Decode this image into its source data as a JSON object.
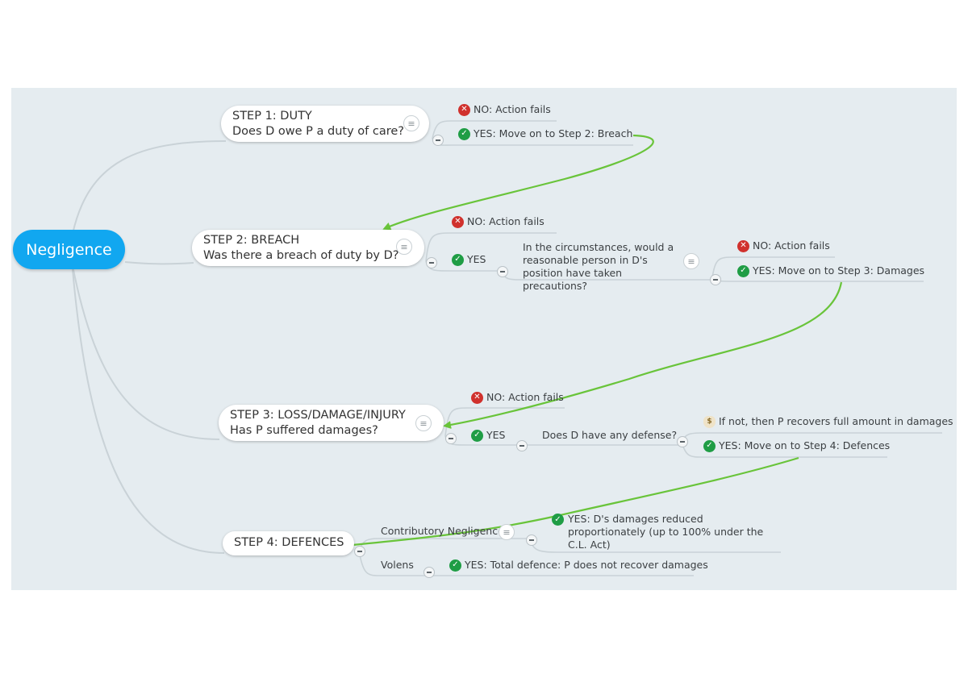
{
  "map": {
    "root": {
      "label": "Negligence",
      "color": "#11a7f0"
    },
    "canvas_color": "#e5ecf0",
    "arrow_color": "#69c43a",
    "steps": [
      {
        "title": "STEP 1: DUTY",
        "question": "Does D owe P a duty of care?",
        "children": [
          {
            "icon": "no-icon",
            "label": "NO: Action fails"
          },
          {
            "icon": "yes-icon",
            "label": "YES: Move on to Step 2: Breach"
          }
        ]
      },
      {
        "title": "STEP 2: BREACH",
        "question": "Was there a breach of duty by D?",
        "children": [
          {
            "icon": "no-icon",
            "label": "NO: Action fails"
          },
          {
            "icon": "yes-icon",
            "label": "YES"
          }
        ],
        "sub": {
          "label": "In the circumstances, would a reasonable person in D's position have taken precautions?",
          "children": [
            {
              "icon": "no-icon",
              "label": "NO: Action fails"
            },
            {
              "icon": "yes-icon",
              "label": "YES: Move on to Step 3: Damages"
            }
          ]
        }
      },
      {
        "title": "STEP 3: LOSS/DAMAGE/INJURY",
        "question": "Has P suffered damages?",
        "children": [
          {
            "icon": "no-icon",
            "label": "NO: Action fails"
          },
          {
            "icon": "yes-icon",
            "label": "YES"
          }
        ],
        "sub": {
          "label": "Does D have any defense?",
          "children": [
            {
              "icon": "money-bag-icon",
              "label": "If not, then P recovers full amount in damages"
            },
            {
              "icon": "yes-icon",
              "label": "YES: Move on to Step 4: Defences"
            }
          ]
        }
      },
      {
        "title": "STEP 4: DEFENCES",
        "children": [
          {
            "label": "Contributory Negligence",
            "child": {
              "icon": "yes-icon",
              "label": "YES: D's damages reduced proportionately (up to 100% under the C.L. Act)"
            }
          },
          {
            "label": "Volens",
            "child": {
              "icon": "yes-icon",
              "label": "YES: Total defence: P does not recover damages"
            }
          }
        ]
      }
    ]
  }
}
